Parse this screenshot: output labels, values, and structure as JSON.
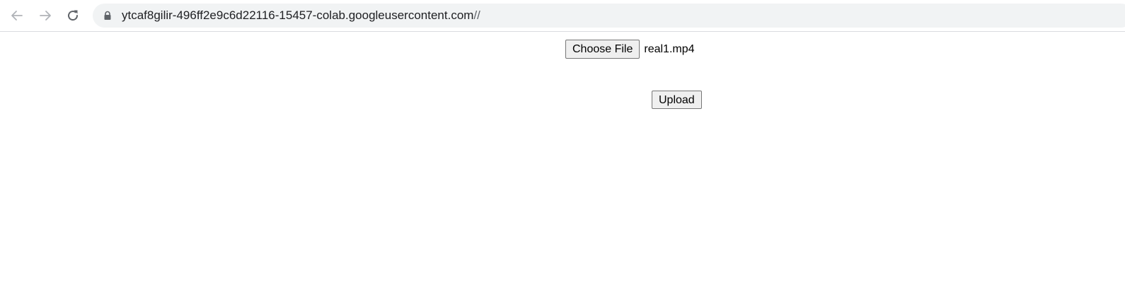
{
  "browser": {
    "url_host": "ytcaf8gilir-496ff2e9c6d22116-15457-colab.googleusercontent.com",
    "url_path": "//",
    "icons": {
      "back": "arrow-left-icon",
      "forward": "arrow-right-icon",
      "reload": "reload-icon",
      "secure": "lock-icon"
    }
  },
  "form": {
    "choose_file_label": "Choose File",
    "selected_file": "real1.mp4",
    "upload_label": "Upload"
  }
}
